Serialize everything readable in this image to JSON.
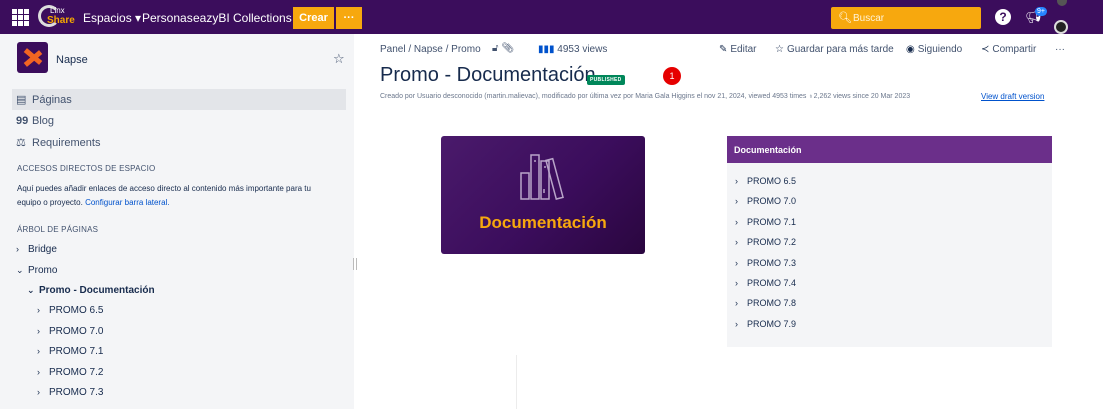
{
  "topbar": {
    "logo_line1": "Linx",
    "logo_line2": "Share",
    "nav": [
      "Espacios ▾",
      "Personas",
      "eazyBI",
      "Collections"
    ],
    "create_label": "Crear",
    "more_label": "···",
    "search_placeholder": "Buscar",
    "help_label": "?",
    "notif_badge": "9+"
  },
  "sidebar": {
    "space_name": "Napse",
    "items": [
      {
        "icon": "▤",
        "label": "Páginas"
      },
      {
        "icon": "99",
        "label": "Blog"
      },
      {
        "icon": "⚖",
        "label": "Requirements"
      }
    ],
    "shortcuts_head": "ACCESOS DIRECTOS DE ESPACIO",
    "shortcuts_desc": "Aquí puedes añadir enlaces de acceso directo al contenido más importante para tu equipo o proyecto.",
    "shortcuts_link": "Configurar barra lateral.",
    "tree_head": "ÁRBOL DE PÁGINAS",
    "tree": [
      {
        "chev": "›",
        "label": "Bridge"
      },
      {
        "chev": "⌄",
        "label": "Promo"
      },
      {
        "chev": "⌄",
        "label": "Promo - Documentación"
      },
      {
        "chev": "›",
        "label": "PROMO 6.5"
      },
      {
        "chev": "›",
        "label": "PROMO 7.0"
      },
      {
        "chev": "›",
        "label": "PROMO 7.1"
      },
      {
        "chev": "›",
        "label": "PROMO 7.2"
      },
      {
        "chev": "›",
        "label": "PROMO 7.3"
      }
    ]
  },
  "main": {
    "breadcrumb": [
      "Panel",
      "Napse",
      "Promo"
    ],
    "views": "4953 views",
    "actions": [
      {
        "icon": "✎",
        "label": "Editar"
      },
      {
        "icon": "☆",
        "label": "Guardar para más tarde"
      },
      {
        "icon": "◉",
        "label": "Siguiendo"
      },
      {
        "icon": "≺",
        "label": "Compartir"
      },
      {
        "icon": "",
        "label": "···"
      }
    ],
    "title": "Promo - Documentación",
    "status": "PUBLISHED",
    "badge_count": "1",
    "byline": "Creado por Usuario desconocido (martin.malievac), modificado por última vez por Maria Gala Higgins el nov 21, 2024, viewed 4953 times  ♁2,262 views since 20 Mar 2023",
    "draft_link": "View draft version",
    "banner_text": "Documentación",
    "panel": {
      "title": "Documentación",
      "items": [
        "PROMO 6.5",
        "PROMO 7.0",
        "PROMO 7.1",
        "PROMO 7.2",
        "PROMO 7.3",
        "PROMO 7.4",
        "PROMO 7.8",
        "PROMO 7.9"
      ]
    }
  },
  "colors": {
    "topbar": "#3b0d5c",
    "accent": "#f7a80e",
    "panel_head": "#6b2f8a",
    "published": "#00875a",
    "link": "#0052cc"
  }
}
